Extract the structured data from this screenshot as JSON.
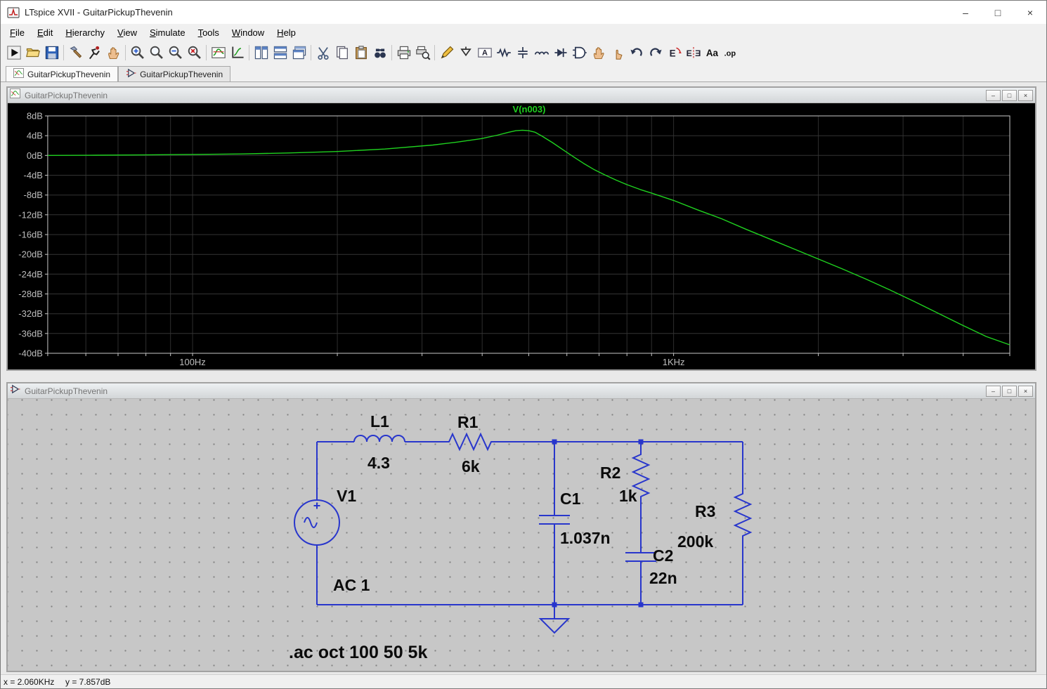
{
  "window": {
    "title": "LTspice XVII - GuitarPickupThevenin",
    "controls": {
      "minimize": "–",
      "maximize": "□",
      "close": "×"
    }
  },
  "menu": {
    "items": [
      "File",
      "Edit",
      "Hierarchy",
      "View",
      "Simulate",
      "Tools",
      "Window",
      "Help"
    ]
  },
  "toolbar": {
    "groups": [
      [
        "run",
        "open",
        "save"
      ],
      [
        "control-panel",
        "run-simulation",
        "halt"
      ],
      [
        "zoom-in",
        "zoom-back",
        "zoom-out",
        "zoom-full"
      ],
      [
        "plot-settings",
        "autorange"
      ],
      [
        "tile-vertical",
        "tile-horizontal",
        "cascade-windows"
      ],
      [
        "cut",
        "copy",
        "paste",
        "find"
      ],
      [
        "print",
        "print-preview"
      ],
      [
        "wire",
        "ground",
        "net-label",
        "resistor",
        "capacitor",
        "inductor",
        "diode",
        "component",
        "move",
        "drag",
        "undo",
        "redo",
        "rotate",
        "mirror",
        "text",
        "spice-directive"
      ]
    ]
  },
  "tabs": [
    {
      "label": "GuitarPickupThevenin",
      "icon": "waveform-plot"
    },
    {
      "label": "GuitarPickupThevenin",
      "icon": "schematic"
    }
  ],
  "plot_window": {
    "title": "GuitarPickupThevenin",
    "controls": {
      "minimize": "–",
      "restore": "□",
      "close": "×"
    }
  },
  "schematic_window": {
    "title": "GuitarPickupThevenin",
    "controls": {
      "minimize": "–",
      "restore": "□",
      "close": "×"
    },
    "source": {
      "ref": "V1",
      "value": "AC 1"
    },
    "components": [
      {
        "ref": "L1",
        "value": "4.3"
      },
      {
        "ref": "R1",
        "value": "6k"
      },
      {
        "ref": "C1",
        "value": "1.037n"
      },
      {
        "ref": "R2",
        "value": "1k"
      },
      {
        "ref": "C2",
        "value": "22n"
      },
      {
        "ref": "R3",
        "value": "200k"
      }
    ],
    "directive": ".ac oct 100 50 5k"
  },
  "chart_data": {
    "type": "line",
    "title": "V(n003)",
    "x_scale": "log",
    "xlim": [
      50,
      5000
    ],
    "ylim": [
      -40,
      8
    ],
    "y_tick_step": 4,
    "y_tick_labels": [
      "8dB",
      "4dB",
      "0dB",
      "-4dB",
      "-8dB",
      "-12dB",
      "-16dB",
      "-20dB",
      "-24dB",
      "-28dB",
      "-32dB",
      "-36dB",
      "-40dB"
    ],
    "x_tick_labels": [
      {
        "f": 100,
        "label": "100Hz"
      },
      {
        "f": 1000,
        "label": "1KHz"
      }
    ],
    "grid": true,
    "background": "#000000",
    "series": [
      {
        "name": "V(n003)",
        "color": "#1fd11f",
        "x": [
          50,
          63,
          79,
          100,
          126,
          158,
          200,
          251,
          316,
          355,
          398,
          430,
          455,
          470,
          485,
          500,
          515,
          533,
          560,
          590,
          620,
          650,
          685,
          722,
          760,
          800,
          853,
          900,
          1000,
          1122,
          1259,
          1413,
          1585,
          1778,
          1995,
          2239,
          2512,
          2818,
          3162,
          3548,
          3981,
          4467,
          5000
        ],
        "y": [
          0.0,
          0.05,
          0.1,
          0.2,
          0.3,
          0.5,
          0.8,
          1.3,
          2.1,
          2.7,
          3.4,
          4.1,
          4.7,
          5.0,
          5.1,
          5.0,
          4.7,
          3.9,
          2.6,
          1.1,
          -0.3,
          -1.6,
          -2.9,
          -4.0,
          -5.0,
          -5.9,
          -6.9,
          -7.6,
          -9.1,
          -11.0,
          -12.8,
          -14.9,
          -16.9,
          -18.9,
          -20.9,
          -22.9,
          -25.0,
          -27.2,
          -29.5,
          -31.9,
          -34.3,
          -36.6,
          -38.3
        ]
      }
    ]
  },
  "status_bar": {
    "x": "x = 2.060KHz",
    "y": "y = 7.857dB"
  },
  "colors": {
    "schematic_wire": "#2836cc",
    "trace_green": "#1fd11f",
    "plot_background": "#000000",
    "grid_line": "#343434",
    "axis_text": "#bdbdbd"
  }
}
